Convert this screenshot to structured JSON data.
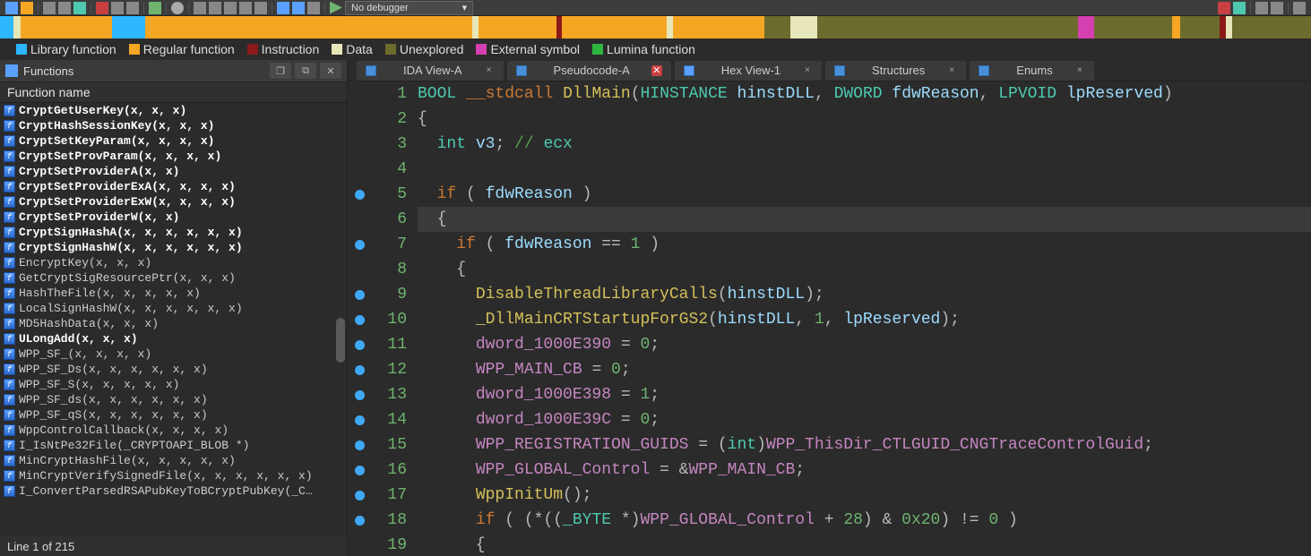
{
  "toolbar": {
    "debugger": "No debugger"
  },
  "legend": [
    {
      "color": "#2eb6ff",
      "label": "Library function"
    },
    {
      "color": "#f5a623",
      "label": "Regular function"
    },
    {
      "color": "#8b1a1a",
      "label": "Instruction"
    },
    {
      "color": "#e6e6b8",
      "label": "Data"
    },
    {
      "color": "#6b6b2e",
      "label": "Unexplored"
    },
    {
      "color": "#d63fb0",
      "label": "External symbol"
    },
    {
      "color": "#2eb63f",
      "label": "Lumina function"
    }
  ],
  "overview": [
    {
      "c": "#2eb6ff",
      "w": 1.0
    },
    {
      "c": "#e6e6b8",
      "w": 0.6
    },
    {
      "c": "#f5a623",
      "w": 7.0
    },
    {
      "c": "#2eb6ff",
      "w": 2.5
    },
    {
      "c": "#f5a623",
      "w": 25
    },
    {
      "c": "#e6e6b8",
      "w": 0.5
    },
    {
      "c": "#f5a623",
      "w": 6
    },
    {
      "c": "#8b1a1a",
      "w": 0.4
    },
    {
      "c": "#f5a623",
      "w": 8
    },
    {
      "c": "#e6e6b8",
      "w": 0.5
    },
    {
      "c": "#f5a623",
      "w": 7
    },
    {
      "c": "#6b6b2e",
      "w": 2
    },
    {
      "c": "#e6e6b8",
      "w": 2
    },
    {
      "c": "#6b6b2e",
      "w": 20
    },
    {
      "c": "#d63fb0",
      "w": 1.2
    },
    {
      "c": "#6b6b2e",
      "w": 6
    },
    {
      "c": "#f5a623",
      "w": 0.6
    },
    {
      "c": "#6b6b2e",
      "w": 3
    },
    {
      "c": "#8b1a1a",
      "w": 0.5
    },
    {
      "c": "#e6e6b8",
      "w": 0.5
    },
    {
      "c": "#6b6b2e",
      "w": 6
    }
  ],
  "functions": {
    "panel_title": "Functions",
    "column": "Function name",
    "status": "Line 1 of 215",
    "items": [
      {
        "n": "CryptGetUserKey(x,x,x)",
        "b": true
      },
      {
        "n": "CryptHashSessionKey(x,x,x)",
        "b": true
      },
      {
        "n": "CryptSetKeyParam(x,x,x,x)",
        "b": true
      },
      {
        "n": "CryptSetProvParam(x,x,x,x)",
        "b": true
      },
      {
        "n": "CryptSetProviderA(x,x)",
        "b": true
      },
      {
        "n": "CryptSetProviderExA(x,x,x,x)",
        "b": true
      },
      {
        "n": "CryptSetProviderExW(x,x,x,x)",
        "b": true
      },
      {
        "n": "CryptSetProviderW(x,x)",
        "b": true
      },
      {
        "n": "CryptSignHashA(x,x,x,x,x,x)",
        "b": true
      },
      {
        "n": "CryptSignHashW(x,x,x,x,x,x)",
        "b": true
      },
      {
        "n": "EncryptKey(x,x,x)",
        "b": false
      },
      {
        "n": "GetCryptSigResourcePtr(x,x,x)",
        "b": false
      },
      {
        "n": "HashTheFile(x,x,x,x,x)",
        "b": false
      },
      {
        "n": "LocalSignHashW(x,x,x,x,x,x)",
        "b": false
      },
      {
        "n": "MD5HashData(x,x,x)",
        "b": false
      },
      {
        "n": "ULongAdd(x,x,x)",
        "b": true
      },
      {
        "n": "WPP_SF_(x,x,x,x)",
        "b": false
      },
      {
        "n": "WPP_SF_Ds(x,x,x,x,x,x)",
        "b": false
      },
      {
        "n": "WPP_SF_S(x,x,x,x,x)",
        "b": false
      },
      {
        "n": "WPP_SF_ds(x,x,x,x,x,x)",
        "b": false
      },
      {
        "n": "WPP_SF_qS(x,x,x,x,x,x)",
        "b": false
      },
      {
        "n": "WppControlCallback(x,x,x,x)",
        "b": false
      },
      {
        "n": "I_IsNtPe32File(_CRYPTOAPI_BLOB *)",
        "b": false
      },
      {
        "n": "MinCryptHashFile(x,x,x,x,x)",
        "b": false
      },
      {
        "n": "MinCryptVerifySignedFile(x,x,x,x,x,x)",
        "b": false
      },
      {
        "n": "I_ConvertParsedRSAPubKeyToBCryptPubKey(_C…",
        "b": false
      }
    ]
  },
  "tabs": [
    {
      "icon": "ida",
      "label": "IDA View-A",
      "close": "x"
    },
    {
      "icon": "pseudo",
      "label": "Pseudocode-A",
      "close": "red"
    },
    {
      "icon": "hex",
      "label": "Hex View-1",
      "close": "x"
    },
    {
      "icon": "struct",
      "label": "Structures",
      "close": "x"
    },
    {
      "icon": "enum",
      "label": "Enums",
      "close": "x"
    }
  ],
  "code": {
    "lines": [
      {
        "n": 1,
        "bp": false
      },
      {
        "n": 2,
        "bp": false
      },
      {
        "n": 3,
        "bp": false
      },
      {
        "n": 4,
        "bp": false
      },
      {
        "n": 5,
        "bp": true
      },
      {
        "n": 6,
        "bp": false,
        "curr": true
      },
      {
        "n": 7,
        "bp": true
      },
      {
        "n": 8,
        "bp": false
      },
      {
        "n": 9,
        "bp": true
      },
      {
        "n": 10,
        "bp": true
      },
      {
        "n": 11,
        "bp": true
      },
      {
        "n": 12,
        "bp": true
      },
      {
        "n": 13,
        "bp": true
      },
      {
        "n": 14,
        "bp": true
      },
      {
        "n": 15,
        "bp": true
      },
      {
        "n": 16,
        "bp": true
      },
      {
        "n": 17,
        "bp": true
      },
      {
        "n": 18,
        "bp": true
      },
      {
        "n": 19,
        "bp": false
      }
    ],
    "src": [
      {
        "t": "BOOL __stdcall DllMain(HINSTANCE hinstDLL, DWORD fdwReason, LPVOID lpReserved)"
      },
      {
        "t": "{"
      },
      {
        "t": "  int v3; // ecx"
      },
      {
        "t": ""
      },
      {
        "t": "  if ( fdwReason )"
      },
      {
        "t": "  {"
      },
      {
        "t": "    if ( fdwReason == 1 )"
      },
      {
        "t": "    {"
      },
      {
        "t": "      DisableThreadLibraryCalls(hinstDLL);"
      },
      {
        "t": "      _DllMainCRTStartupForGS2(hinstDLL, 1, lpReserved);"
      },
      {
        "t": "      dword_1000E390 = 0;"
      },
      {
        "t": "      WPP_MAIN_CB = 0;"
      },
      {
        "t": "      dword_1000E398 = 1;"
      },
      {
        "t": "      dword_1000E39C = 0;"
      },
      {
        "t": "      WPP_REGISTRATION_GUIDS = (int)WPP_ThisDir_CTLGUID_CNGTraceControlGuid;"
      },
      {
        "t": "      WPP_GLOBAL_Control = &WPP_MAIN_CB;"
      },
      {
        "t": "      WppInitUm();"
      },
      {
        "t": "      if ( (*((_BYTE *)WPP_GLOBAL_Control + 28) & 0x20) != 0 )"
      },
      {
        "t": "      {"
      }
    ]
  }
}
